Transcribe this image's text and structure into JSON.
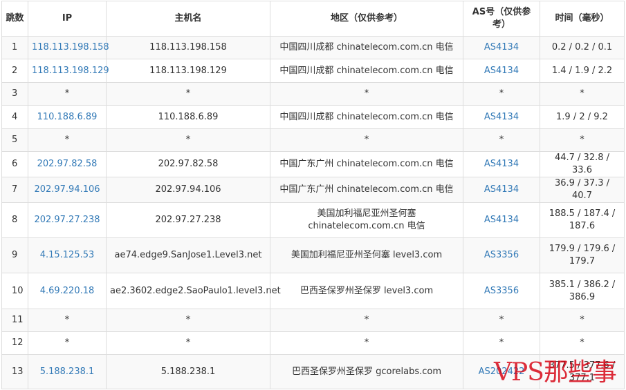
{
  "headers": {
    "hop": "跳数",
    "ip": "IP",
    "host": "主机名",
    "region": "地区（仅供参考）",
    "asn": "AS号（仅供参考）",
    "time": "时间（毫秒）"
  },
  "rows": [
    {
      "hop": "1",
      "ip": "118.113.198.158",
      "host": "118.113.198.158",
      "region": "中国四川成都 chinatelecom.com.cn 电信",
      "asn": "AS4134",
      "time": "0.2 / 0.2 / 0.1"
    },
    {
      "hop": "2",
      "ip": "118.113.198.129",
      "host": "118.113.198.129",
      "region": "中国四川成都 chinatelecom.com.cn 电信",
      "asn": "AS4134",
      "time": "1.4 / 1.9 / 2.2"
    },
    {
      "hop": "3",
      "ip": "*",
      "host": "*",
      "region": "*",
      "asn": "*",
      "time": "*"
    },
    {
      "hop": "4",
      "ip": "110.188.6.89",
      "host": "110.188.6.89",
      "region": "中国四川成都 chinatelecom.com.cn 电信",
      "asn": "AS4134",
      "time": "1.9 / 2 / 9.2"
    },
    {
      "hop": "5",
      "ip": "*",
      "host": "*",
      "region": "*",
      "asn": "*",
      "time": "*"
    },
    {
      "hop": "6",
      "ip": "202.97.82.58",
      "host": "202.97.82.58",
      "region": "中国广东广州 chinatelecom.com.cn 电信",
      "asn": "AS4134",
      "time": "44.7 / 32.8 / 33.6"
    },
    {
      "hop": "7",
      "ip": "202.97.94.106",
      "host": "202.97.94.106",
      "region": "中国广东广州 chinatelecom.com.cn 电信",
      "asn": "AS4134",
      "time": "36.9 / 37.3 / 40.7"
    },
    {
      "hop": "8",
      "ip": "202.97.27.238",
      "host": "202.97.27.238",
      "region": "美国加利福尼亚州圣何塞 chinatelecom.com.cn 电信",
      "asn": "AS4134",
      "time": "188.5 / 187.4 / 187.6"
    },
    {
      "hop": "9",
      "ip": "4.15.125.53",
      "host": "ae74.edge9.SanJose1.Level3.net",
      "region": "美国加利福尼亚州圣何塞 level3.com",
      "asn": "AS3356",
      "time": "179.9 / 179.6 / 179.7"
    },
    {
      "hop": "10",
      "ip": "4.69.220.18",
      "host": "ae2.3602.edge2.SaoPaulo1.level3.net",
      "region": "巴西圣保罗州圣保罗 level3.com",
      "asn": "AS3356",
      "time": "385.1 / 386.2 / 386.9"
    },
    {
      "hop": "11",
      "ip": "*",
      "host": "*",
      "region": "*",
      "asn": "*",
      "time": "*"
    },
    {
      "hop": "12",
      "ip": "*",
      "host": "*",
      "region": "*",
      "asn": "*",
      "time": "*"
    },
    {
      "hop": "13",
      "ip": "5.188.238.1",
      "host": "5.188.238.1",
      "region": "巴西圣保罗州圣保罗 gcorelabs.com",
      "asn": "AS202422",
      "time": "377.5 / 377.6 / 377.1"
    }
  ],
  "watermark": "VPS那些事",
  "colors": {
    "link": "#337ab7",
    "stripe": "#f9f9f9",
    "border": "#dddddd",
    "watermark": "#d6000f"
  }
}
